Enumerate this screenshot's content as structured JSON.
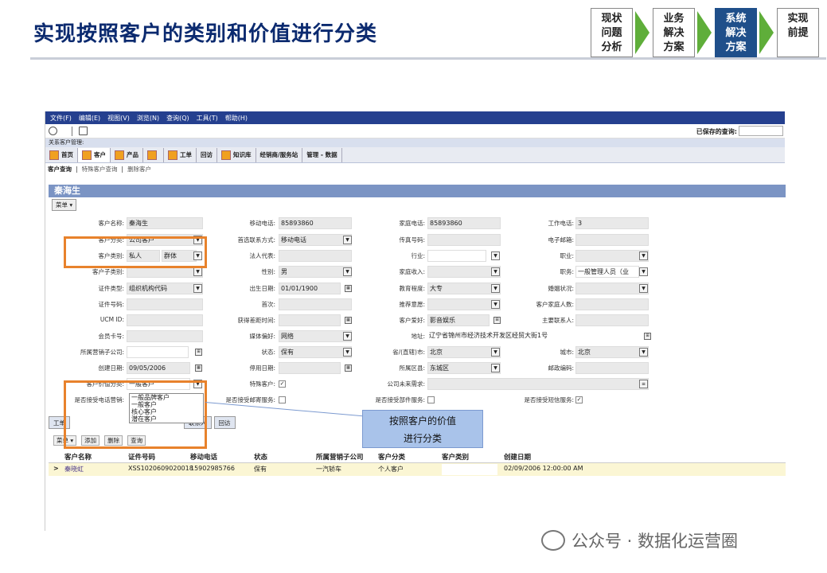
{
  "slide": {
    "title": "实现按照客户的类别和价值进行分类"
  },
  "steps": [
    {
      "label": "现状\n问题\n分析"
    },
    {
      "label": "业务\n解决\n方案"
    },
    {
      "label": "系统\n解决\n方案"
    },
    {
      "label": "实现\n前提"
    }
  ],
  "app": {
    "menus": [
      "文件(F)",
      "编辑(E)",
      "视图(V)",
      "浏览(N)",
      "查询(Q)",
      "工具(T)",
      "帮助(H)"
    ],
    "saved_query_label": "已保存的查询:",
    "breadcrumb": "关系客户管理:",
    "nav": [
      "首页",
      "客户",
      "产品",
      "",
      "工单",
      "回访",
      "知识库",
      "经销商/服务站",
      "管理 - 数据"
    ],
    "subnav": {
      "current": "客户查询",
      "link1": "特殊客户查询",
      "link2": "删除客户",
      "sep": "|"
    },
    "record_title": "秦海生",
    "menu_button": "菜单 ▾",
    "fields": {
      "customer_name": {
        "label": "客户名称:",
        "value": "秦海生"
      },
      "customer_class": {
        "label": "客户分类:",
        "value": "公司客户"
      },
      "customer_type": {
        "label": "客户类别:",
        "value": "私人",
        "value2": "群体"
      },
      "customer_subtype": {
        "label": "客户子类别:",
        "value": ""
      },
      "id_type": {
        "label": "证件类型:",
        "value": "组织机构代码"
      },
      "id_no": {
        "label": "证件号码:",
        "value": ""
      },
      "ucm_id": {
        "label": "UCM ID:",
        "value": ""
      },
      "member_card": {
        "label": "会员卡号:",
        "value": ""
      },
      "sales_company": {
        "label": "所属营销子公司:",
        "value": ""
      },
      "created_date": {
        "label": "创建日期:",
        "value": "09/05/2006"
      },
      "value_class": {
        "label": "客户价值分类:",
        "value": "一般客户"
      },
      "accept_phone": {
        "label": "是否接受电话营销:",
        "value": ""
      },
      "mobile": {
        "label": "移动电话:",
        "value": "85893860"
      },
      "first_contact": {
        "label": "首选联系方式:",
        "value": "移动电话"
      },
      "legal_rep": {
        "label": "法人代表:",
        "value": ""
      },
      "gender": {
        "label": "性别:",
        "value": "男"
      },
      "birthday": {
        "label": "出生日期:",
        "value": "01/01/1900"
      },
      "first": {
        "label": "首次:",
        "value": ""
      },
      "time_obtain": {
        "label": "获得差距时间:",
        "value": ""
      },
      "media": {
        "label": "媒体偏好:",
        "value": "网络"
      },
      "status": {
        "label": "状态:",
        "value": "保有"
      },
      "stop_date": {
        "label": "停用日期:",
        "value": ""
      },
      "special": {
        "label": "特殊客户:",
        "value": ""
      },
      "accept_mail": {
        "label": "是否接受邮寄服务:",
        "value": ""
      },
      "home_phone": {
        "label": "家庭电话:",
        "value": "85893860"
      },
      "fax": {
        "label": "传真号码:",
        "value": ""
      },
      "industry": {
        "label": "行业:",
        "value": ""
      },
      "income": {
        "label": "家庭收入:",
        "value": ""
      },
      "education": {
        "label": "教育程度:",
        "value": "大专"
      },
      "recommend": {
        "label": "推荐意愿:",
        "value": ""
      },
      "hobby": {
        "label": "客户爱好:",
        "value": "影音娱乐"
      },
      "address": {
        "label": "地址:",
        "value": "辽宁省锦州市经济技术开发区经贸大街1号"
      },
      "province": {
        "label": "省/(直辖)市:",
        "value": "北京"
      },
      "district": {
        "label": "所属区县:",
        "value": "东城区"
      },
      "future_req": {
        "label": "公司未来需求:",
        "value": ""
      },
      "accept_parts": {
        "label": "是否接受部件服务:",
        "value": ""
      },
      "work_phone": {
        "label": "工作电话:",
        "value": "3"
      },
      "email": {
        "label": "电子邮箱:",
        "value": ""
      },
      "job": {
        "label": "职业:",
        "value": ""
      },
      "position": {
        "label": "职务:",
        "value": "一般管理人员（业"
      },
      "marital": {
        "label": "婚姻状况:",
        "value": ""
      },
      "family_size": {
        "label": "客户家庭人数:",
        "value": ""
      },
      "main_contact": {
        "label": "主要联系人:",
        "value": ""
      },
      "city": {
        "label": "城市:",
        "value": "北京"
      },
      "zip": {
        "label": "邮政编码:",
        "value": ""
      },
      "accept_sms": {
        "label": "是否接受短信服务:",
        "value": ""
      }
    },
    "value_options": [
      "一般品牌客户",
      "一般客户",
      "核心客户",
      "潜在客户"
    ],
    "tabs": [
      "工单",
      "",
      "",
      "联系人",
      "回访"
    ],
    "grid_buttons": [
      "菜单 ▾",
      "添加",
      "删除",
      "查询"
    ],
    "grid_columns": [
      "客户名称",
      "证件号码",
      "移动电话",
      "状态",
      "所属营销子公司",
      "客户分类",
      "客户类别",
      "创建日期"
    ],
    "grid_rows": [
      [
        "秦晓虹",
        "XSS1020609020018",
        "15902985766",
        "保有",
        "一汽轿车",
        "个人客户",
        "",
        "02/09/2006 12:00:00 AM"
      ]
    ],
    "row_marker": ">"
  },
  "callout": {
    "line1": "按照客户的价值",
    "line2": "进行分类"
  },
  "watermark": "公众号 · 数据化运营圈",
  "colors": {
    "title": "#0b2a6f",
    "menubar": "#25408f",
    "active_step": "#1f4f8a",
    "arrow": "#5fae3a",
    "highlight": "#e8822c",
    "callout": "#a9c3ea"
  }
}
